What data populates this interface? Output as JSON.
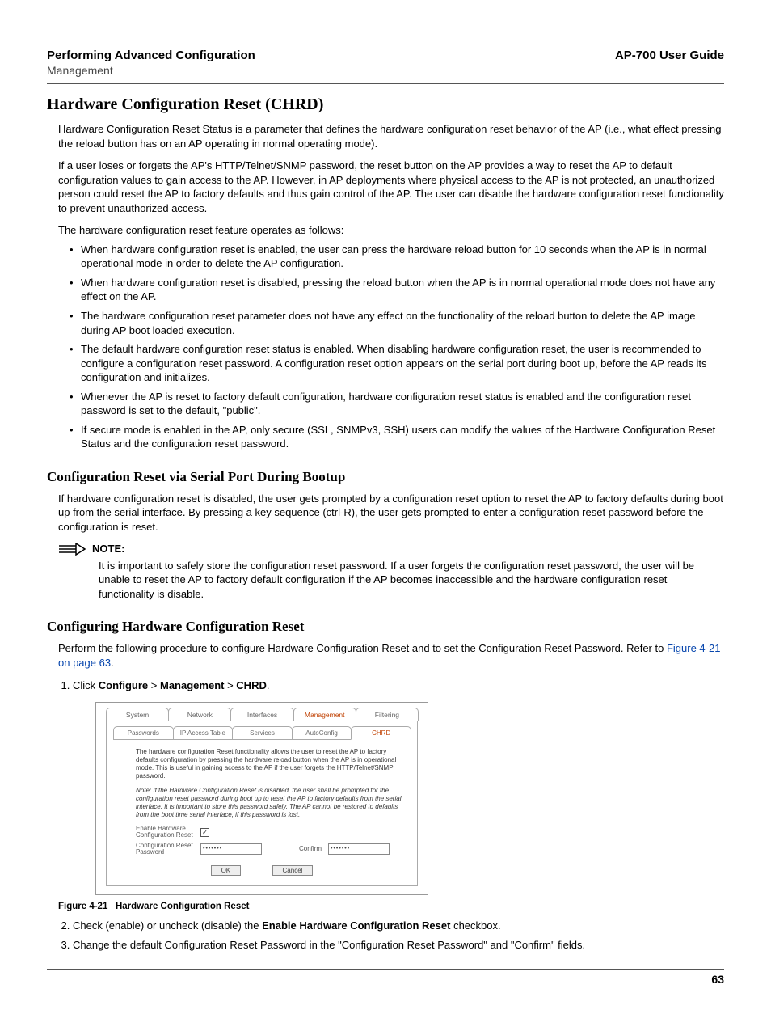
{
  "header": {
    "left_title": "Performing Advanced Configuration",
    "left_sub": "Management",
    "right": "AP-700 User Guide"
  },
  "h1": "Hardware Configuration Reset (CHRD)",
  "para1": "Hardware Configuration Reset Status is a parameter that defines the hardware configuration reset behavior of the AP (i.e., what effect pressing the reload button has on an AP operating in normal operating mode).",
  "para2": "If a user loses or forgets the AP's HTTP/Telnet/SNMP password, the reset button on the AP provides a way to reset the AP to default configuration values to gain access to the AP. However, in AP deployments where physical access to the AP is not protected, an unauthorized person could reset the AP to factory defaults and thus gain control of the AP. The user can disable the hardware configuration reset functionality to prevent unauthorized access.",
  "para3": "The hardware configuration reset feature operates as follows:",
  "bullets": [
    "When hardware configuration reset is enabled, the user can press the hardware reload button for 10 seconds when the AP is in normal operational mode in order to delete the AP configuration.",
    "When hardware configuration reset is disabled, pressing the reload button when the AP is in normal operational mode does not have any effect on the AP.",
    "The hardware configuration reset parameter does not have any effect on the functionality of the reload button to delete the AP image during AP boot loaded execution.",
    "The default hardware configuration reset status is enabled. When disabling hardware configuration reset, the user is recommended to configure a configuration reset password. A configuration reset option appears on the serial port during boot up, before the AP reads its configuration and initializes.",
    "Whenever the AP is reset to factory default configuration, hardware configuration reset status is enabled and the configuration reset password is set to the default, \"public\".",
    "If secure mode is enabled in the AP, only secure (SSL, SNMPv3, SSH) users can modify the values of the Hardware Configuration Reset Status and the configuration reset password."
  ],
  "h2a": "Configuration Reset via Serial Port During Bootup",
  "para_serial": "If hardware configuration reset is disabled, the user gets prompted by a configuration reset option to reset the AP to factory defaults during boot up from the serial interface. By pressing a key sequence (ctrl-R), the user gets prompted to enter a configuration reset password before the configuration is reset.",
  "note": {
    "label": "NOTE:",
    "body": "It is important to safely store the configuration reset password. If a user forgets the configuration reset password, the user will be unable to reset the AP to factory default configuration if the AP becomes inaccessible and the hardware configuration reset functionality is disable."
  },
  "h2b": "Configuring Hardware Configuration Reset",
  "proc_intro_a": "Perform the following procedure to configure Hardware Configuration Reset and to set the Configuration Reset Password. Refer to ",
  "proc_intro_link": "Figure 4-21 on page 63",
  "proc_intro_b": ".",
  "step1": {
    "pre": "Click ",
    "b1": "Configure",
    "sep": " > ",
    "b2": "Management",
    "b3": "CHRD",
    "post": "."
  },
  "screenshot": {
    "tabs": [
      "System",
      "Network",
      "Interfaces",
      "Management",
      "Filtering"
    ],
    "active_tab": "Management",
    "subtabs": [
      "Passwords",
      "IP Access Table",
      "Services",
      "AutoConfig",
      "CHRD"
    ],
    "active_subtab": "CHRD",
    "desc1": "The hardware configuration Reset functionality allows the user to reset the AP to factory defaults configuration by pressing the hardware reload button when the AP is in operational mode. This is useful in gaining access to the AP if the user forgets the HTTP/Telnet/SNMP password.",
    "desc2": "Note: If the Hardware Configuration Reset is disabled, the user shall be prompted for the configuration reset password during boot up to reset the AP to factory defaults from the serial interface. It is important to store this password safely. The AP cannot be restored to defaults from the boot time serial interface, if this password is lost.",
    "label_enable": "Enable Hardware Configuration Reset",
    "checkbox_mark": "✓",
    "label_pwd": "Configuration Reset Password",
    "pwd_val": "•••••••",
    "label_confirm": "Confirm",
    "confirm_val": "•••••••",
    "btn_ok": "OK",
    "btn_cancel": "Cancel"
  },
  "figcap_a": "Figure 4-21",
  "figcap_b": "Hardware Configuration Reset",
  "step2": {
    "pre": "Check (enable) or uncheck (disable) the ",
    "bold": "Enable Hardware Configuration Reset",
    "post": " checkbox."
  },
  "step3": "Change the default Configuration Reset Password in the \"Configuration Reset Password\" and \"Confirm\" fields.",
  "pagenum": "63"
}
